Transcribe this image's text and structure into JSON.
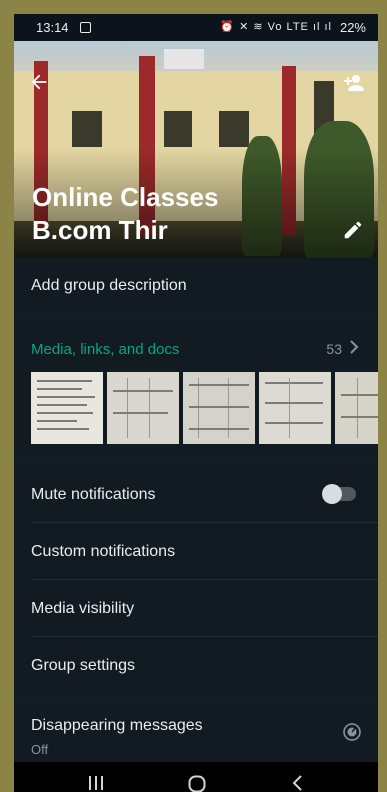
{
  "status_bar": {
    "time": "13:14",
    "system_icons": "⏰ ✕ ≋ Vo LTE ıl ıl",
    "battery": "22%"
  },
  "header": {
    "title_line1": "Online Classes",
    "title_line2": "B.com Thir",
    "back_icon": "arrow-left-icon",
    "add_participant_icon": "add-person-icon",
    "edit_icon": "pencil-icon"
  },
  "description": {
    "label": "Add group description"
  },
  "media": {
    "title": "Media, links, and docs",
    "count": "53",
    "chevron": "chevron-right-icon"
  },
  "settings": {
    "mute": {
      "label": "Mute notifications",
      "enabled": false
    },
    "custom": {
      "label": "Custom notifications"
    },
    "visibility": {
      "label": "Media visibility"
    },
    "group": {
      "label": "Group settings"
    }
  },
  "disappearing": {
    "label": "Disappearing messages",
    "value": "Off"
  },
  "navigation": {
    "recents_icon": "recents-icon",
    "home_icon": "home-icon",
    "back_icon": "back-chevron-icon"
  },
  "colors": {
    "accent": "#00a884",
    "background": "#111b21",
    "text": "#e9edef",
    "muted": "#8696a0"
  }
}
